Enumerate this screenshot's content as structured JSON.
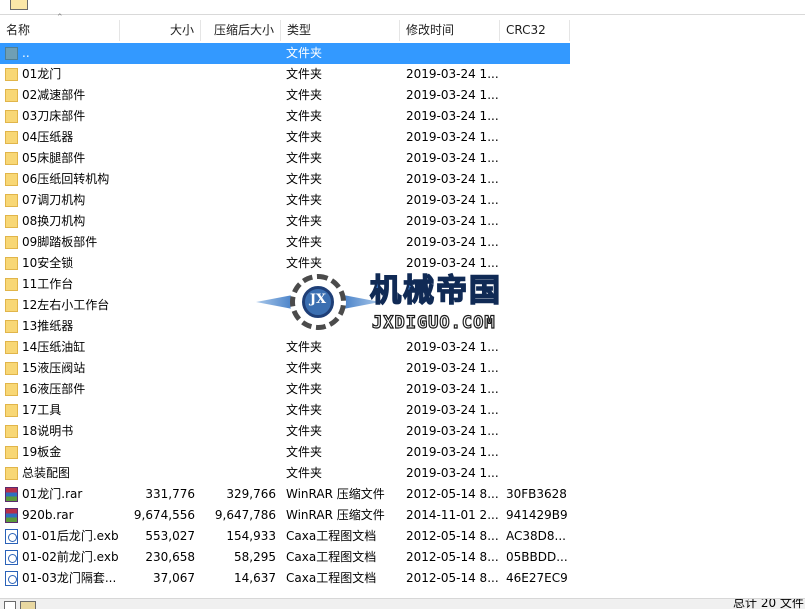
{
  "columns": {
    "name": "名称",
    "size": "大小",
    "packed": "压缩后大小",
    "type": "类型",
    "modified": "修改时间",
    "crc": "CRC32"
  },
  "files": [
    {
      "name": "..",
      "size": "",
      "packed": "",
      "type": "文件夹",
      "modified": "",
      "crc": "",
      "icon": "folder-up-icon",
      "selected": true
    },
    {
      "name": "01龙门",
      "size": "",
      "packed": "",
      "type": "文件夹",
      "modified": "2019-03-24 1...",
      "crc": "",
      "icon": "folder-icon"
    },
    {
      "name": "02减速部件",
      "size": "",
      "packed": "",
      "type": "文件夹",
      "modified": "2019-03-24 1...",
      "crc": "",
      "icon": "folder-icon"
    },
    {
      "name": "03刀床部件",
      "size": "",
      "packed": "",
      "type": "文件夹",
      "modified": "2019-03-24 1...",
      "crc": "",
      "icon": "folder-icon"
    },
    {
      "name": "04压纸器",
      "size": "",
      "packed": "",
      "type": "文件夹",
      "modified": "2019-03-24 1...",
      "crc": "",
      "icon": "folder-icon"
    },
    {
      "name": "05床腿部件",
      "size": "",
      "packed": "",
      "type": "文件夹",
      "modified": "2019-03-24 1...",
      "crc": "",
      "icon": "folder-icon"
    },
    {
      "name": "06压纸回转机构",
      "size": "",
      "packed": "",
      "type": "文件夹",
      "modified": "2019-03-24 1...",
      "crc": "",
      "icon": "folder-icon"
    },
    {
      "name": "07调刀机构",
      "size": "",
      "packed": "",
      "type": "文件夹",
      "modified": "2019-03-24 1...",
      "crc": "",
      "icon": "folder-icon"
    },
    {
      "name": "08换刀机构",
      "size": "",
      "packed": "",
      "type": "文件夹",
      "modified": "2019-03-24 1...",
      "crc": "",
      "icon": "folder-icon"
    },
    {
      "name": "09脚踏板部件",
      "size": "",
      "packed": "",
      "type": "文件夹",
      "modified": "2019-03-24 1...",
      "crc": "",
      "icon": "folder-icon"
    },
    {
      "name": "10安全锁",
      "size": "",
      "packed": "",
      "type": "文件夹",
      "modified": "2019-03-24 1...",
      "crc": "",
      "icon": "folder-icon"
    },
    {
      "name": "11工作台",
      "size": "",
      "packed": "",
      "type": "",
      "modified": "",
      "crc": "",
      "icon": "folder-icon"
    },
    {
      "name": "12左右小工作台",
      "size": "",
      "packed": "",
      "type": "",
      "modified": "",
      "crc": "",
      "icon": "folder-icon"
    },
    {
      "name": "13推纸器",
      "size": "",
      "packed": "",
      "type": "",
      "modified": "",
      "crc": "",
      "icon": "folder-icon"
    },
    {
      "name": "14压纸油缸",
      "size": "",
      "packed": "",
      "type": "文件夹",
      "modified": "2019-03-24 1...",
      "crc": "",
      "icon": "folder-icon"
    },
    {
      "name": "15液压阀站",
      "size": "",
      "packed": "",
      "type": "文件夹",
      "modified": "2019-03-24 1...",
      "crc": "",
      "icon": "folder-icon"
    },
    {
      "name": "16液压部件",
      "size": "",
      "packed": "",
      "type": "文件夹",
      "modified": "2019-03-24 1...",
      "crc": "",
      "icon": "folder-icon"
    },
    {
      "name": "17工具",
      "size": "",
      "packed": "",
      "type": "文件夹",
      "modified": "2019-03-24 1...",
      "crc": "",
      "icon": "folder-icon"
    },
    {
      "name": "18说明书",
      "size": "",
      "packed": "",
      "type": "文件夹",
      "modified": "2019-03-24 1...",
      "crc": "",
      "icon": "folder-icon"
    },
    {
      "name": "19板金",
      "size": "",
      "packed": "",
      "type": "文件夹",
      "modified": "2019-03-24 1...",
      "crc": "",
      "icon": "folder-icon"
    },
    {
      "name": "总装配图",
      "size": "",
      "packed": "",
      "type": "文件夹",
      "modified": "2019-03-24 1...",
      "crc": "",
      "icon": "folder-icon"
    },
    {
      "name": "01龙门.rar",
      "size": "331,776",
      "packed": "329,766",
      "type": "WinRAR 压缩文件",
      "modified": "2012-05-14 8...",
      "crc": "30FB3628",
      "icon": "rar-archive-icon"
    },
    {
      "name": "920b.rar",
      "size": "9,674,556",
      "packed": "9,647,786",
      "type": "WinRAR 压缩文件",
      "modified": "2014-11-01 2...",
      "crc": "941429B9",
      "icon": "rar-archive-icon"
    },
    {
      "name": "01-01后龙门.exb",
      "size": "553,027",
      "packed": "154,933",
      "type": "Caxa工程图文档",
      "modified": "2012-05-14 8...",
      "crc": "AC38D8...",
      "icon": "caxa-document-icon"
    },
    {
      "name": "01-02前龙门.exb",
      "size": "230,658",
      "packed": "58,295",
      "type": "Caxa工程图文档",
      "modified": "2012-05-14 8...",
      "crc": "05BBDD...",
      "icon": "caxa-document-icon"
    },
    {
      "name": "01-03龙门隔套...",
      "size": "37,067",
      "packed": "14,637",
      "type": "Caxa工程图文档",
      "modified": "2012-05-14 8...",
      "crc": "46E27EC9",
      "icon": "caxa-document-icon"
    }
  ],
  "watermark": {
    "logo_text": "JX",
    "title": "机械帝国",
    "subtitle": "JXDIGUO.COM"
  },
  "status": {
    "text": "总计 20 文件"
  },
  "colors": {
    "selection": "#3399ff",
    "folder": "#f8d775"
  }
}
